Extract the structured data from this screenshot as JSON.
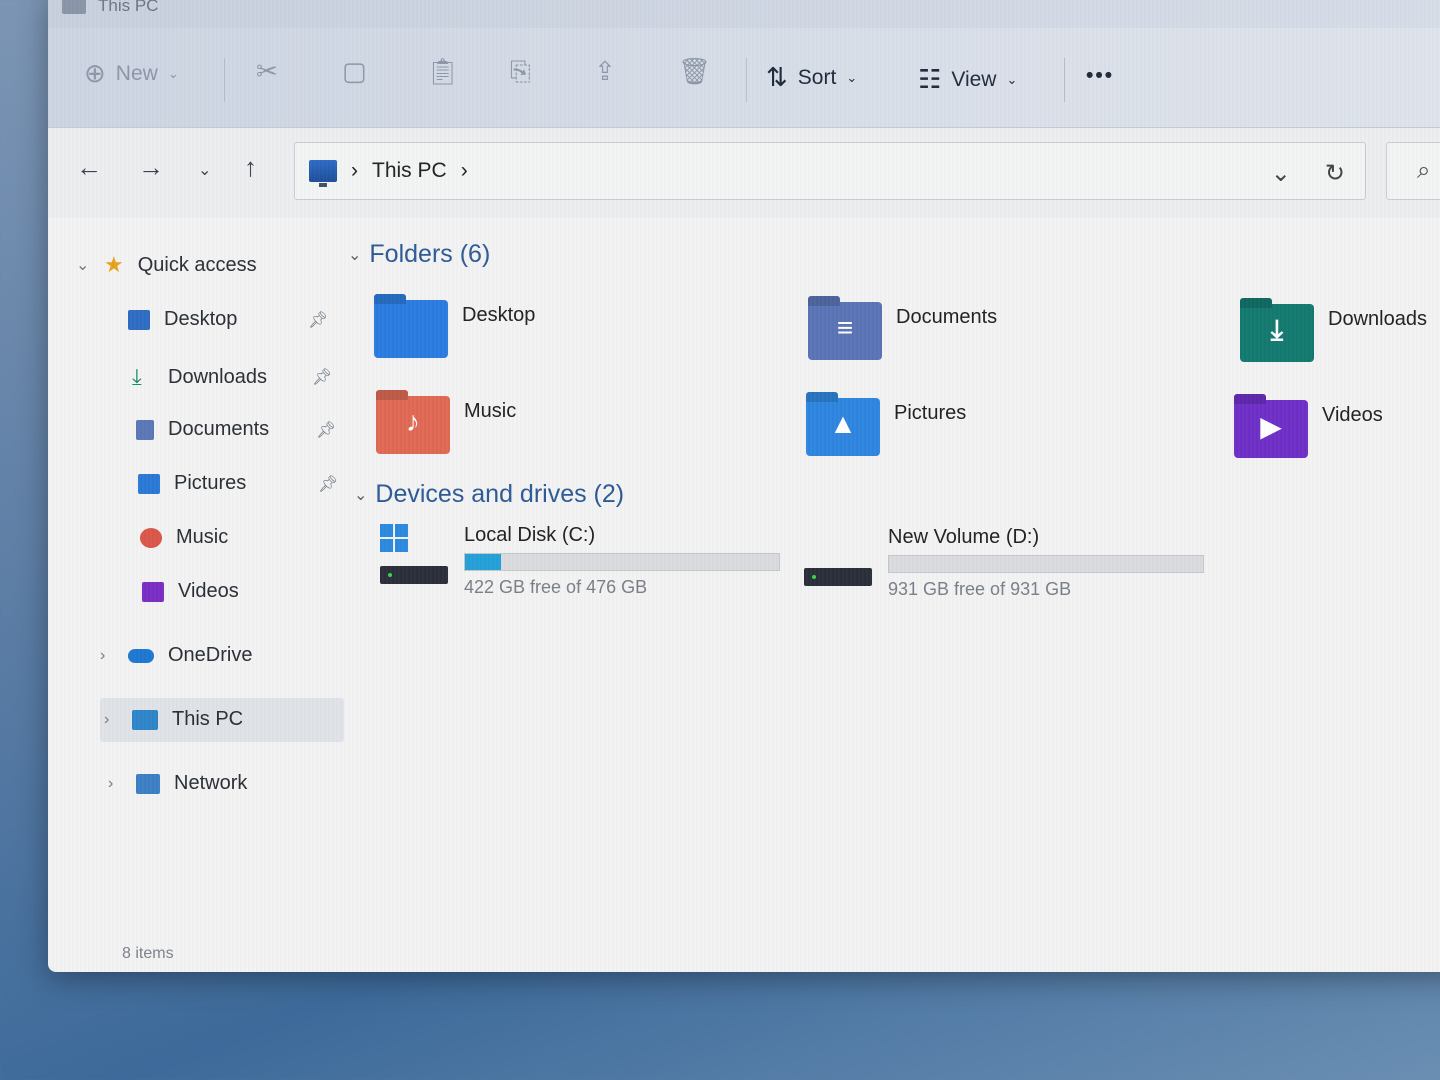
{
  "window": {
    "title": "This PC"
  },
  "toolbar": {
    "new_label": "New",
    "sort_label": "Sort",
    "view_label": "View",
    "more_label": "•••"
  },
  "address": {
    "path": "This PC"
  },
  "sidebar": {
    "quick_access": "Quick access",
    "items": [
      {
        "label": "Desktop",
        "icon": "desktop-icon",
        "color": "#2f6cc4"
      },
      {
        "label": "Downloads",
        "icon": "download-icon",
        "color": "#1b8a6b"
      },
      {
        "label": "Documents",
        "icon": "documents-icon",
        "color": "#5b78b8"
      },
      {
        "label": "Pictures",
        "icon": "pictures-icon",
        "color": "#2a79d4"
      },
      {
        "label": "Music",
        "icon": "music-icon",
        "color": "#d9584a"
      },
      {
        "label": "Videos",
        "icon": "videos-icon",
        "color": "#7a2fc4"
      }
    ],
    "onedrive": "OneDrive",
    "this_pc": "This PC",
    "network": "Network"
  },
  "content": {
    "folders_header": "Folders (6)",
    "folders": [
      {
        "label": "Desktop",
        "color": "#2b7be0",
        "sym": ""
      },
      {
        "label": "Documents",
        "color": "#5a74b6",
        "sym": "≡"
      },
      {
        "label": "Downloads",
        "color": "#137a70",
        "sym": "⤓"
      },
      {
        "label": "Music",
        "color": "#e06a55",
        "sym": "♪"
      },
      {
        "label": "Pictures",
        "color": "#2f86e0",
        "sym": "▲"
      },
      {
        "label": "Videos",
        "color": "#6f2fc8",
        "sym": "▶"
      }
    ],
    "drives_header": "Devices and drives (2)",
    "drives": [
      {
        "name": "Local Disk (C:)",
        "free": "422 GB free of 476 GB",
        "used_fraction": 0.114
      },
      {
        "name": "New Volume (D:)",
        "free": "931 GB free of 931 GB",
        "used_fraction": 0.0
      }
    ]
  },
  "status": {
    "items": "8 items"
  }
}
